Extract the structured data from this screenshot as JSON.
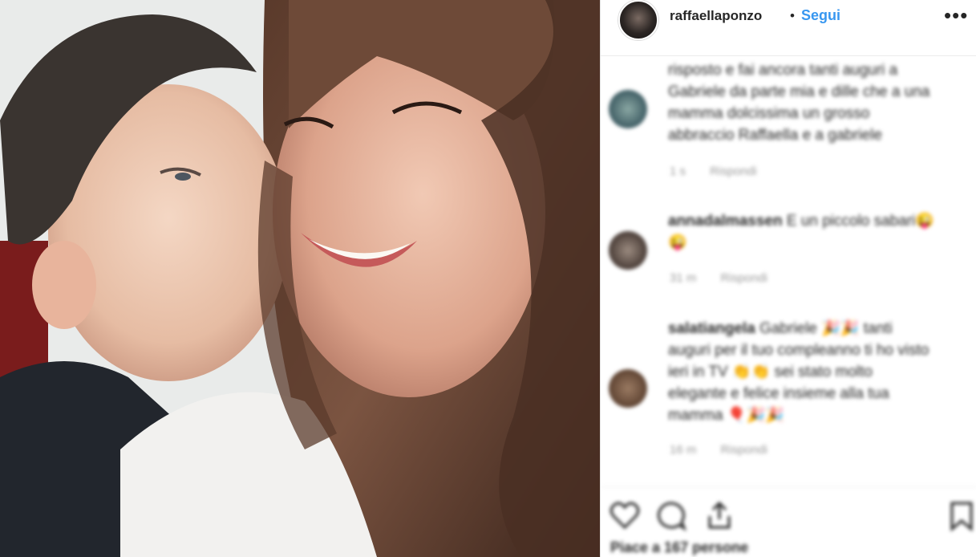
{
  "post": {
    "username": "raffaellaponzo",
    "separator": "•",
    "follow_label": "Segui",
    "more_icon": "more-options-icon"
  },
  "comments": [
    {
      "lines": [
        "risposto e fai ancora tanti auguri a",
        "Gabriele da parte mia e dille che a una",
        "mamma dolcissima un grosso",
        "abbraccio Raffaella e a gabriele"
      ],
      "time": "1 s",
      "reply": "Rispondi"
    },
    {
      "user": "annadalmassen",
      "lines": [
        "E un piccolo sabari😜",
        "😜"
      ],
      "time": "31 m",
      "reply": "Rispondi"
    },
    {
      "user": "salatiangela",
      "lines": [
        "Gabriele 🎉🎉 tanti",
        "auguri per il tuo compleanno ti ho visto",
        "ieri in TV 👏👏 sei stato molto",
        "elegante e felice insieme alla tua",
        "mamma 🎈🎉🎉"
      ],
      "time": "16 m",
      "reply": "Rispondi"
    }
  ],
  "footer": {
    "likes_text": "Piace a 167 persone",
    "icons": [
      "heart-icon",
      "comment-icon",
      "share-icon",
      "bookmark-icon"
    ]
  },
  "colors": {
    "accent": "#3897f0",
    "text": "#262626",
    "muted": "#999999"
  }
}
